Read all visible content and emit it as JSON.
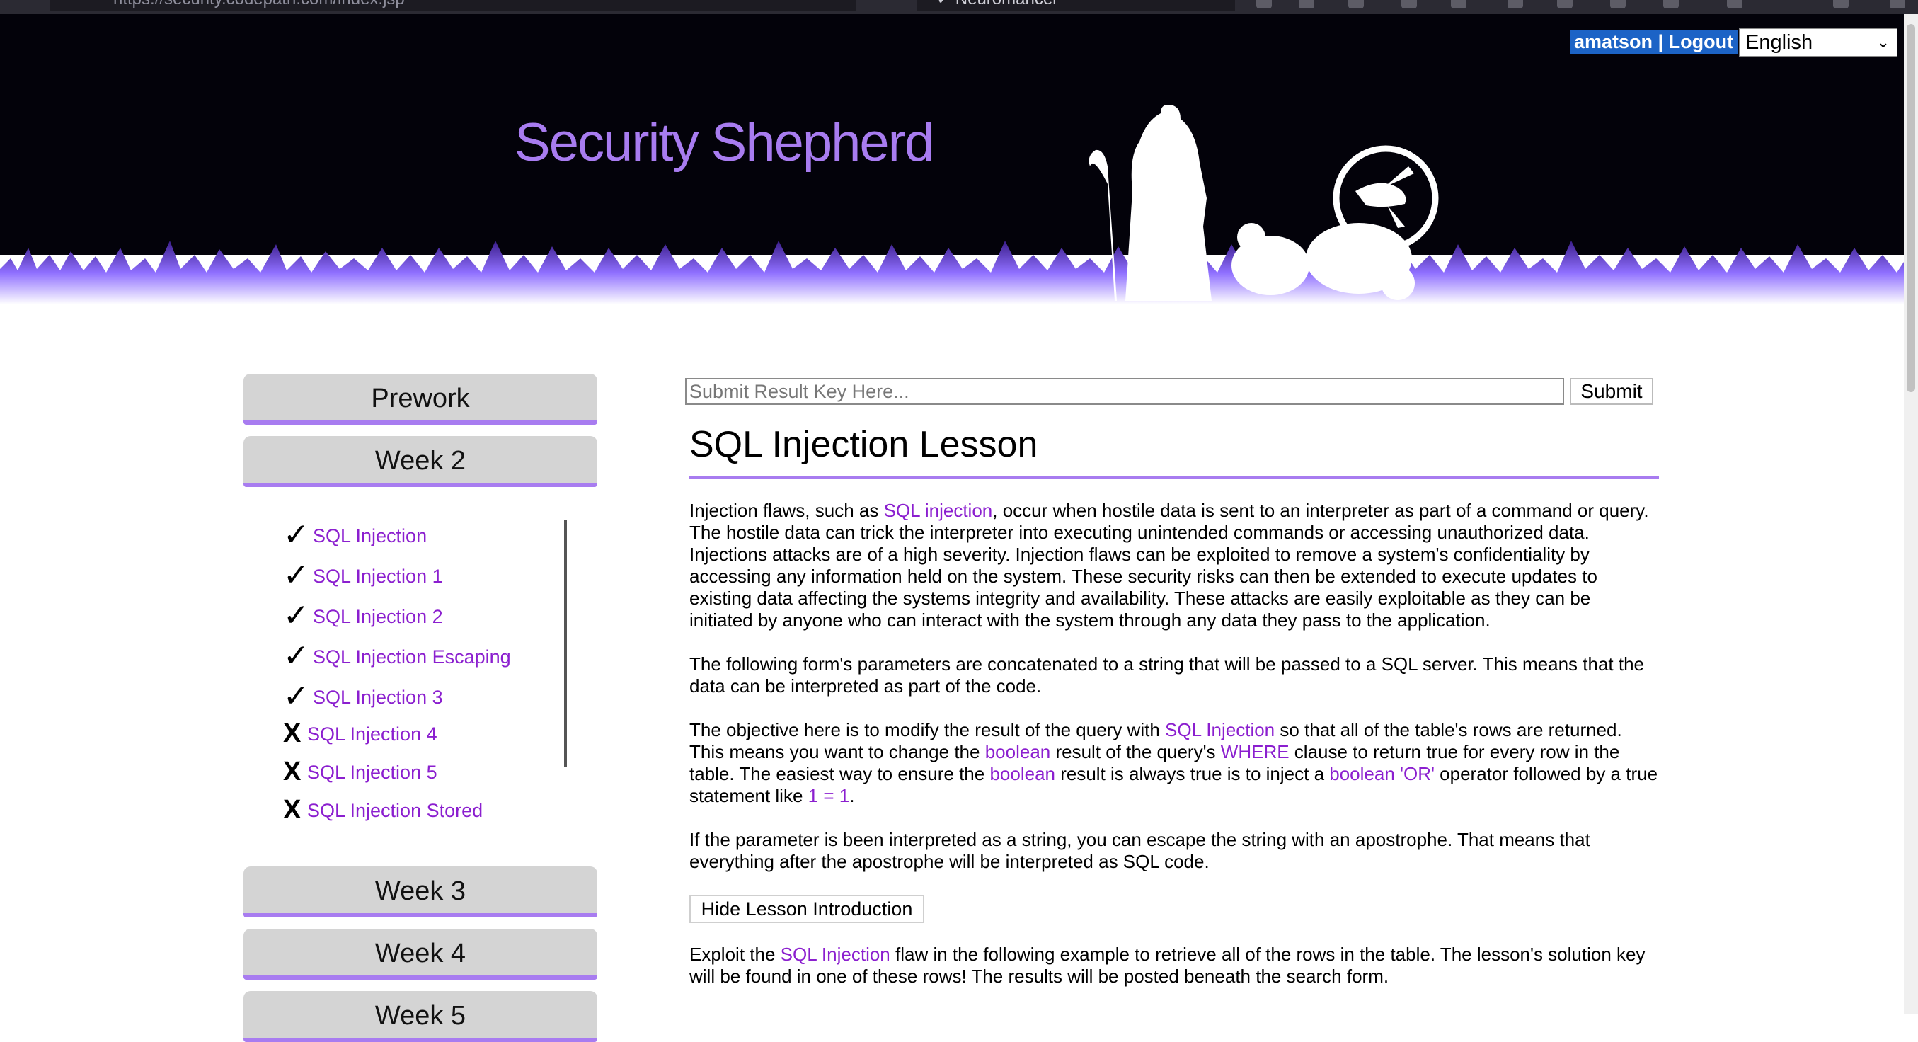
{
  "browser": {
    "url_fragment": "https://security.codepath.com/index.jsp",
    "tab_fragment": "✓ Neuromancer"
  },
  "header": {
    "site_title": "Security Shepherd",
    "user_name": "amatson",
    "separator": " | ",
    "logout_label": "Logout",
    "language": "English"
  },
  "sidebar": {
    "sections": [
      {
        "label": "Prework"
      },
      {
        "label": "Week 2"
      },
      {
        "label": "Week 3"
      },
      {
        "label": "Week 4"
      },
      {
        "label": "Week 5"
      }
    ],
    "lessons": [
      {
        "label": "SQL Injection",
        "status": "completed",
        "mark": "✓"
      },
      {
        "label": "SQL Injection 1",
        "status": "completed",
        "mark": "✓"
      },
      {
        "label": "SQL Injection 2",
        "status": "completed",
        "mark": "✓"
      },
      {
        "label": "SQL Injection Escaping",
        "status": "completed",
        "mark": "✓"
      },
      {
        "label": "SQL Injection 3",
        "status": "completed",
        "mark": "✓"
      },
      {
        "label": "SQL Injection 4",
        "status": "incomplete",
        "mark": "X"
      },
      {
        "label": "SQL Injection 5",
        "status": "incomplete",
        "mark": "X"
      },
      {
        "label": "SQL Injection Stored",
        "status": "incomplete",
        "mark": "X"
      }
    ]
  },
  "main": {
    "result_placeholder": "Submit Result Key Here...",
    "submit_label": "Submit",
    "lesson_title": "SQL Injection Lesson",
    "p1": {
      "a": "Injection flaws, such as ",
      "link": "SQL injection",
      "b": ", occur when hostile data is sent to an interpreter as part of a command or query. The hostile data can trick the interpreter into executing unintended commands or accessing unauthorized data. Injections attacks are of a high severity. Injection flaws can be exploited to remove a system's confidentiality by accessing any information held on the system. These security risks can then be extended to execute updates to existing data affecting the systems integrity and availability. These attacks are easily exploitable as they can be initiated by anyone who can interact with the system through any data they pass to the application."
    },
    "p2": "The following form's parameters are concatenated to a string that will be passed to a SQL server. This means that the data can be interpreted as part of the code.",
    "p3": {
      "a": "The objective here is to modify the result of the query with ",
      "h1": "SQL Injection",
      "b": " so that all of the table's rows are returned. This means you want to change the ",
      "h2": "boolean",
      "c": " result of the query's ",
      "h3": "WHERE",
      "d": " clause to return true for every row in the table. The easiest way to ensure the ",
      "h4": "boolean",
      "e": " result is always true is to inject a ",
      "h5": "boolean 'OR'",
      "f": " operator followed by a true statement like ",
      "h6": "1 = 1",
      "g": "."
    },
    "p4": "If the parameter is been interpreted as a string, you can escape the string with an apostrophe. That means that everything after the apostrophe will be interpreted as SQL code.",
    "hide_label": "Hide Lesson Introduction",
    "p5": {
      "a": "Exploit the ",
      "h1": "SQL Injection",
      "b": " flaw in the following example to retrieve all of the rows in the table. The lesson's solution key will be found in one of these rows! The results will be posted beneath the search form."
    }
  },
  "colors": {
    "accent": "#a87cf0",
    "link": "#8b1fcf",
    "header_bg": "#03020a",
    "selection": "#1c63c6"
  }
}
